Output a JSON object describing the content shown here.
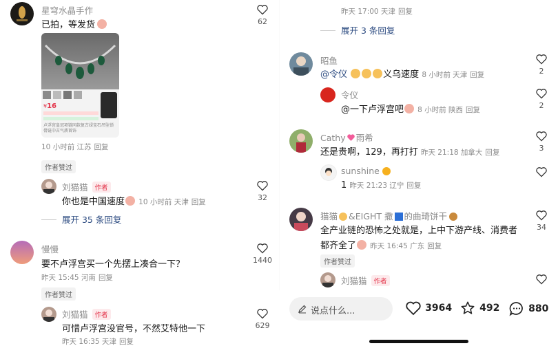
{
  "left": {
    "comment1": {
      "user": "星穹水晶手作",
      "text": "已拍，等发货",
      "meta": "10 小时前 江苏",
      "reply": "回复",
      "likes": "62",
      "badge": "作者赞过",
      "product": {
        "price_currency": "¥",
        "price": "16",
        "snippet": "卢浮宫皇冠项链同款复古绿宝石吊坠锁骨链中古气质首饰"
      }
    },
    "reply1": {
      "user": "刘猫猫",
      "author_tag": "作者",
      "text": "你也是中国速度",
      "meta": "10 小时前 天津",
      "reply": "回复",
      "likes": "32"
    },
    "expand1": "展开 35 条回复",
    "comment2": {
      "user": "慢慢",
      "text": "要不卢浮宫买一个先摆上凑合一下？",
      "meta": "昨天 15:45 河南",
      "reply": "回复",
      "likes": "1440",
      "badge": "作者赞过"
    },
    "reply2": {
      "user": "刘猫猫",
      "author_tag": "作者",
      "text": "可惜卢浮宫没官号，不然艾特他一下",
      "meta": "昨天 16:35 天津",
      "reply": "回复",
      "likes": "629"
    }
  },
  "right": {
    "top_meta": "昨天 17:00 天津",
    "top_reply": "回复",
    "expand0": "展开 3 条回复",
    "comment3": {
      "user": "昭鱼",
      "mention": "@令仪",
      "text": "义乌速度",
      "meta": "8 小时前 天津",
      "reply": "回复",
      "likes": "2"
    },
    "reply3": {
      "user": "令仪",
      "text": "@一下卢浮宫吧",
      "meta": "8 小时前 陕西",
      "reply": "回复",
      "likes": "2"
    },
    "comment4": {
      "user": "Cathy",
      "user_suffix": "雨希",
      "text": "还是贵啊，129，再打打",
      "meta": "昨天 21:18 加拿大",
      "reply": "回复",
      "likes": "3"
    },
    "reply4": {
      "user": "sunshine",
      "text": "1",
      "meta": "昨天 21:23 辽宁",
      "reply": "回复",
      "likes": ""
    },
    "comment5": {
      "user_a": "猫猫",
      "user_b": "&EIGHT 撒",
      "user_c": "的曲琦饼干",
      "text_line1": "全产业链的恐怖之处就是，上中下游产线、消费者",
      "text_line2": "都齐全了",
      "meta": "昨天 16:45 广东",
      "reply": "回复",
      "likes": "34",
      "badge": "作者赞过"
    },
    "reply5": {
      "user": "刘猫猫",
      "author_tag": "作者"
    },
    "bottom": {
      "placeholder": "说点什么...",
      "likes": "3964",
      "stars": "492",
      "comments": "880"
    }
  },
  "colors": {
    "accent_blue": "#2b4a80",
    "author_red": "#e3344a",
    "meta_gray": "#8a8a8a"
  }
}
